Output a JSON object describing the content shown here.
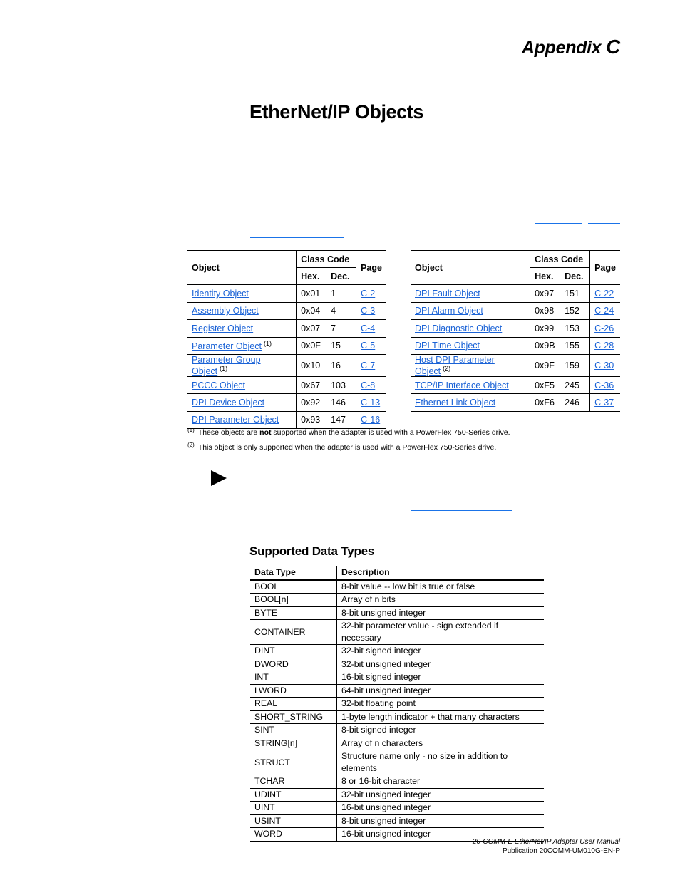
{
  "header": {
    "appendix_label": "Appendix",
    "appendix_letter": "C"
  },
  "page_title": "EtherNet/IP Objects",
  "objects_table": {
    "headers": {
      "object": "Object",
      "class_code": "Class Code",
      "page": "Page",
      "hex": "Hex.",
      "dec": "Dec."
    },
    "left": [
      {
        "name": "Identity Object",
        "note": "",
        "hex": "0x01",
        "dec": "1",
        "page": "C-2"
      },
      {
        "name": "Assembly Object",
        "note": "",
        "hex": "0x04",
        "dec": "4",
        "page": "C-3"
      },
      {
        "name": "Register Object",
        "note": "",
        "hex": "0x07",
        "dec": "7",
        "page": "C-4"
      },
      {
        "name": "Parameter Object",
        "note": "(1)",
        "hex": "0x0F",
        "dec": "15",
        "page": "C-5"
      },
      {
        "name": "Parameter Group Object",
        "note": "(1)",
        "hex": "0x10",
        "dec": "16",
        "page": "C-7"
      },
      {
        "name": "PCCC Object",
        "note": "",
        "hex": "0x67",
        "dec": "103",
        "page": "C-8"
      },
      {
        "name": "DPI Device Object",
        "note": "",
        "hex": "0x92",
        "dec": "146",
        "page": "C-13"
      },
      {
        "name": "DPI Parameter Object",
        "note": "",
        "hex": "0x93",
        "dec": "147",
        "page": "C-16"
      }
    ],
    "right": [
      {
        "name": "DPI Fault Object",
        "note": "",
        "hex": "0x97",
        "dec": "151",
        "page": "C-22"
      },
      {
        "name": "DPI Alarm Object",
        "note": "",
        "hex": "0x98",
        "dec": "152",
        "page": "C-24"
      },
      {
        "name": "DPI Diagnostic Object",
        "note": "",
        "hex": "0x99",
        "dec": "153",
        "page": "C-26"
      },
      {
        "name": "DPI Time Object",
        "note": "",
        "hex": "0x9B",
        "dec": "155",
        "page": "C-28"
      },
      {
        "name": "Host DPI Parameter Object",
        "note": "(2)",
        "hex": "0x9F",
        "dec": "159",
        "page": "C-30"
      },
      {
        "name": "TCP/IP Interface Object",
        "note": "",
        "hex": "0xF5",
        "dec": "245",
        "page": "C-36"
      },
      {
        "name": "Ethernet Link Object",
        "note": "",
        "hex": "0xF6",
        "dec": "246",
        "page": "C-37"
      }
    ]
  },
  "footnotes": [
    {
      "mark": "(1)",
      "before": "These objects are ",
      "bold": "not",
      "after": " supported when the adapter is used with a PowerFlex 750-Series drive."
    },
    {
      "mark": "(2)",
      "before": "This object is only supported when the adapter is used with a PowerFlex 750-Series drive.",
      "bold": "",
      "after": ""
    }
  ],
  "data_types": {
    "heading": "Supported Data Types",
    "headers": {
      "type": "Data Type",
      "description": "Description"
    },
    "rows": [
      {
        "type": "BOOL",
        "description": "8-bit value -- low bit is true or false"
      },
      {
        "type": "BOOL[n]",
        "description": "Array of n bits"
      },
      {
        "type": "BYTE",
        "description": "8-bit unsigned integer"
      },
      {
        "type": "CONTAINER",
        "description": "32-bit parameter value - sign extended if necessary"
      },
      {
        "type": "DINT",
        "description": "32-bit signed integer"
      },
      {
        "type": "DWORD",
        "description": "32-bit unsigned integer"
      },
      {
        "type": "INT",
        "description": "16-bit signed integer"
      },
      {
        "type": "LWORD",
        "description": "64-bit unsigned integer"
      },
      {
        "type": "REAL",
        "description": "32-bit floating point"
      },
      {
        "type": "SHORT_STRING",
        "description": "1-byte length indicator + that many characters"
      },
      {
        "type": "SINT",
        "description": "8-bit signed integer"
      },
      {
        "type": "STRING[n]",
        "description": "Array of n characters"
      },
      {
        "type": "STRUCT",
        "description": "Structure name only - no size in addition to elements"
      },
      {
        "type": "TCHAR",
        "description": "8 or 16-bit character"
      },
      {
        "type": "UDINT",
        "description": "32-bit unsigned integer"
      },
      {
        "type": "UINT",
        "description": "16-bit unsigned integer"
      },
      {
        "type": "USINT",
        "description": "8-bit unsigned integer"
      },
      {
        "type": "WORD",
        "description": "16-bit unsigned integer"
      }
    ]
  },
  "footer": {
    "manual": "20-COMM-E EtherNet/IP Adapter User Manual",
    "publication": "Publication 20COMM-UM010G-EN-P"
  },
  "colors": {
    "link": "#1a62d6"
  }
}
